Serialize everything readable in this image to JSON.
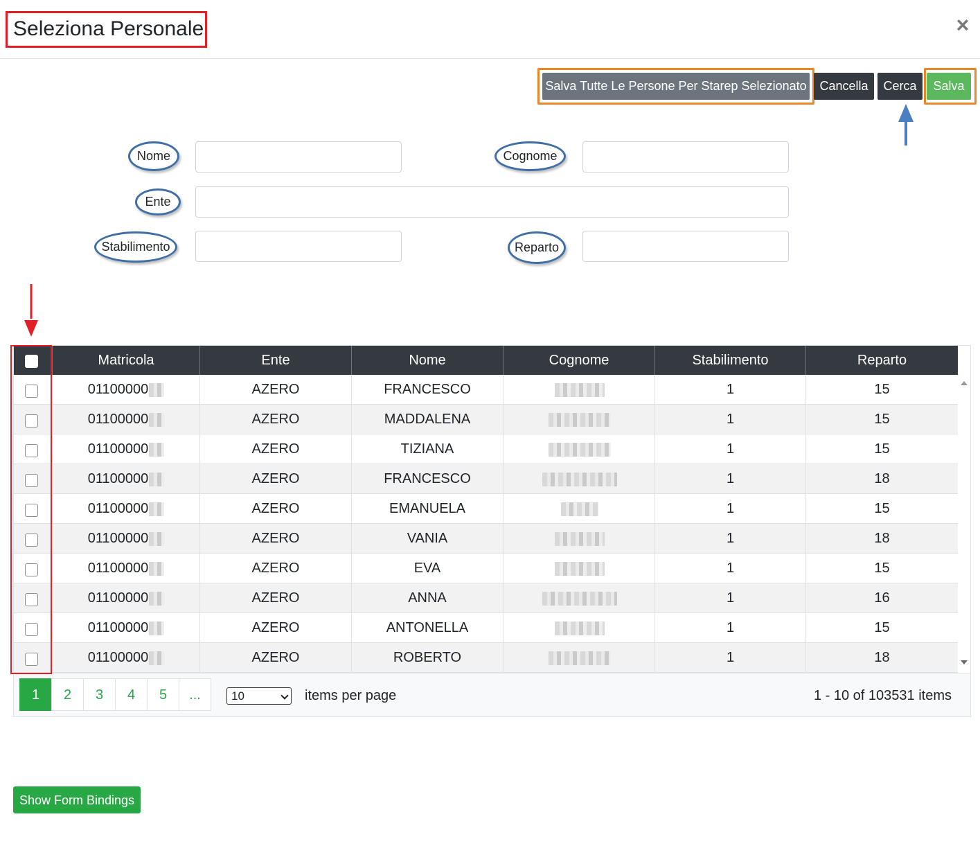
{
  "modal": {
    "title": "Seleziona Personale",
    "close_label": "×"
  },
  "toolbar": {
    "save_all_label": "Salva Tutte Le Persone Per Starep Selezionato",
    "cancel_label": "Cancella",
    "search_label": "Cerca",
    "save_label": "Salva"
  },
  "filters": {
    "nome_label": "Nome",
    "cognome_label": "Cognome",
    "ente_label": "Ente",
    "stabilimento_label": "Stabilimento",
    "reparto_label": "Reparto"
  },
  "grid": {
    "columns": [
      "Matricola",
      "Ente",
      "Nome",
      "Cognome",
      "Stabilimento",
      "Reparto"
    ],
    "rows": [
      {
        "matricola": "01100000",
        "ente": "AZERO",
        "nome": "FRANCESCO",
        "stabilimento": "1",
        "reparto": "15"
      },
      {
        "matricola": "01100000",
        "ente": "AZERO",
        "nome": "MADDALENA",
        "stabilimento": "1",
        "reparto": "15"
      },
      {
        "matricola": "01100000",
        "ente": "AZERO",
        "nome": "TIZIANA",
        "stabilimento": "1",
        "reparto": "15"
      },
      {
        "matricola": "01100000",
        "ente": "AZERO",
        "nome": "FRANCESCO",
        "stabilimento": "1",
        "reparto": "18"
      },
      {
        "matricola": "01100000",
        "ente": "AZERO",
        "nome": "EMANUELA",
        "stabilimento": "1",
        "reparto": "15"
      },
      {
        "matricola": "01100000",
        "ente": "AZERO",
        "nome": "VANIA",
        "stabilimento": "1",
        "reparto": "18"
      },
      {
        "matricola": "01100000",
        "ente": "AZERO",
        "nome": "EVA",
        "stabilimento": "1",
        "reparto": "15"
      },
      {
        "matricola": "01100000",
        "ente": "AZERO",
        "nome": "ANNA",
        "stabilimento": "1",
        "reparto": "16"
      },
      {
        "matricola": "01100000",
        "ente": "AZERO",
        "nome": "ANTONELLA",
        "stabilimento": "1",
        "reparto": "15"
      },
      {
        "matricola": "01100000",
        "ente": "AZERO",
        "nome": "ROBERTO",
        "stabilimento": "1",
        "reparto": "18"
      }
    ]
  },
  "pager": {
    "pages": [
      "1",
      "2",
      "3",
      "4",
      "5",
      "..."
    ],
    "active_page": "1",
    "page_size": "10",
    "items_per_page_label": "items per page",
    "summary": "1 - 10 of 103531 items"
  },
  "footer": {
    "show_bindings_label": "Show Form Bindings"
  },
  "colors": {
    "header_bg": "#343a40",
    "accent_green": "#28a745",
    "save_green": "#5cb85c",
    "annotation_red": "#e21f26",
    "annotation_orange": "#e8882a",
    "annotation_blue": "#3f6fa6"
  }
}
